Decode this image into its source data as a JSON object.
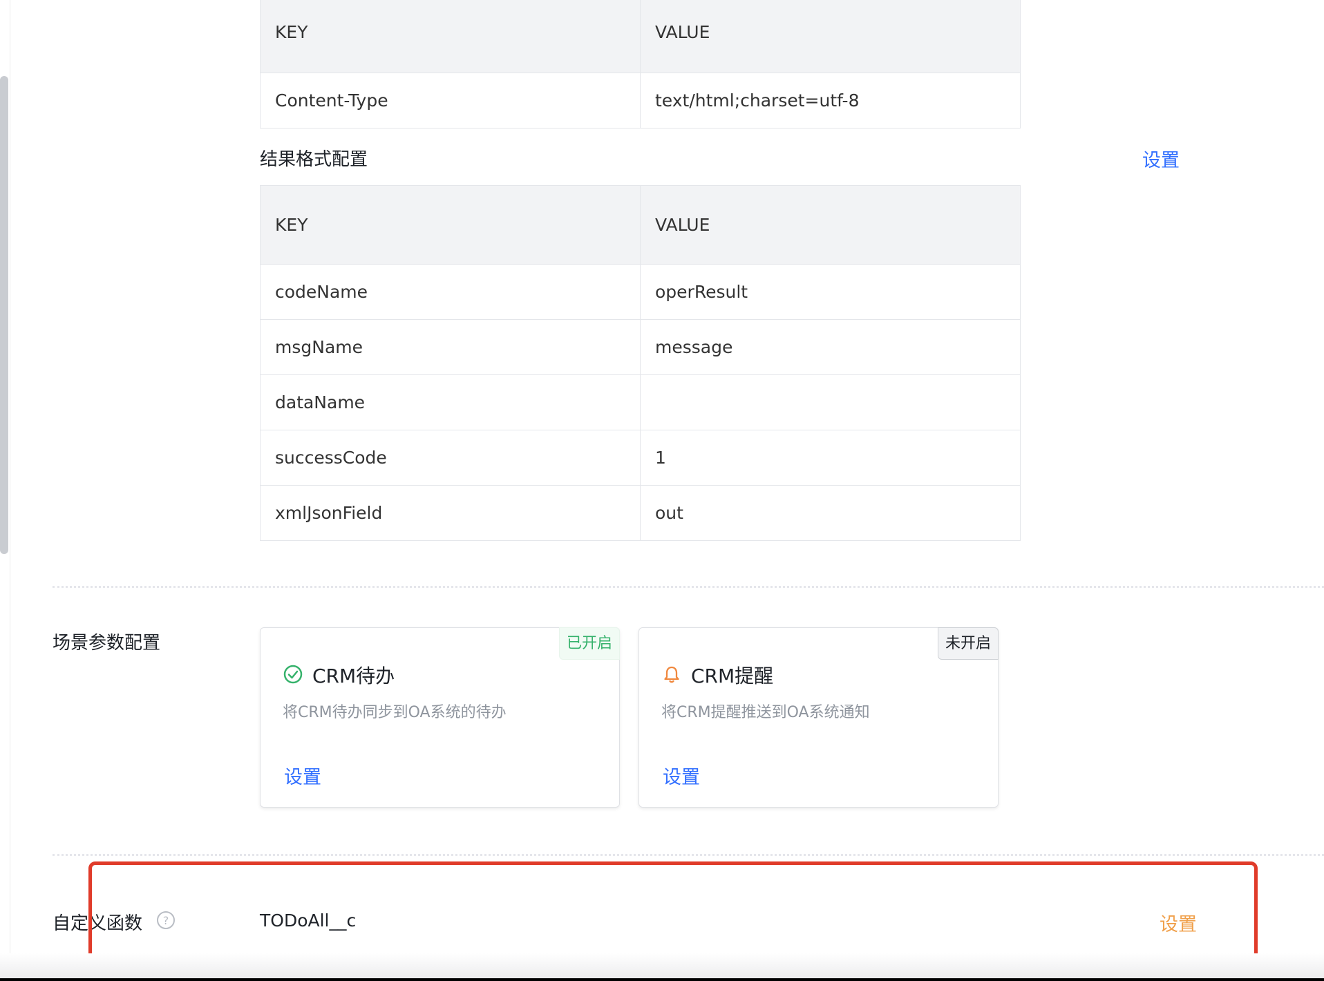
{
  "header_table": {
    "columns": [
      "KEY",
      "VALUE"
    ],
    "rows": [
      {
        "key": "Content-Type",
        "value": "text/html;charset=utf-8"
      }
    ]
  },
  "result_format": {
    "title": "结果格式配置",
    "settings_label": "设置",
    "columns": [
      "KEY",
      "VALUE"
    ],
    "rows": [
      {
        "key": "codeName",
        "value": "operResult"
      },
      {
        "key": "msgName",
        "value": "message"
      },
      {
        "key": "dataName",
        "value": ""
      },
      {
        "key": "successCode",
        "value": "1"
      },
      {
        "key": "xmlJsonField",
        "value": "out"
      }
    ]
  },
  "scene_params": {
    "title": "场景参数配置",
    "cards": [
      {
        "icon": "check-circle-icon",
        "status": "已开启",
        "name": "CRM待办",
        "description": "将CRM待办同步到OA系统的待办",
        "settings_label": "设置"
      },
      {
        "icon": "bell-icon",
        "status": "未开启",
        "name": "CRM提醒",
        "description": "将CRM提醒推送到OA系统通知",
        "settings_label": "设置"
      }
    ]
  },
  "custom_function": {
    "label": "自定义函数",
    "value": "TODoAll__c",
    "settings_label": "设置"
  },
  "colors": {
    "link_blue": "#3370ff",
    "link_orange": "#f0a04b",
    "status_on_green": "#35b26b",
    "highlight_red": "#e03b2a",
    "table_header_bg": "#f2f3f5"
  }
}
